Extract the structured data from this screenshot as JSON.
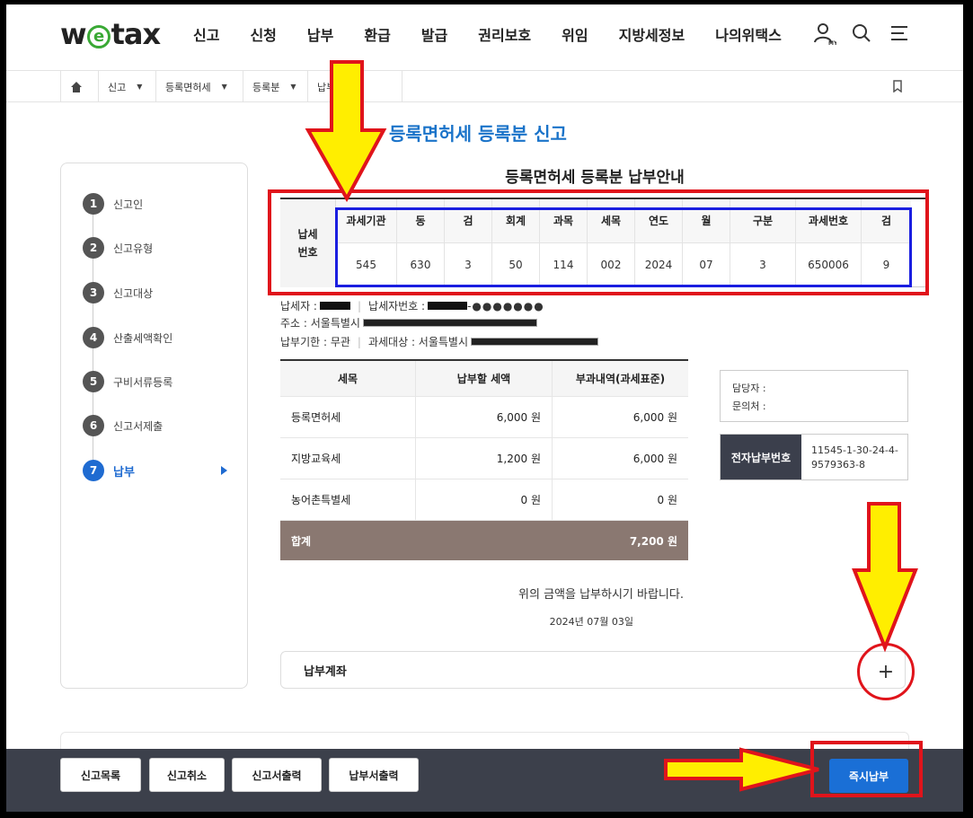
{
  "header": {
    "logo": "wetax",
    "nav": [
      "신고",
      "신청",
      "납부",
      "환급",
      "발급",
      "권리보호",
      "위임",
      "지방세정보",
      "나의위택스"
    ],
    "icons": [
      "user-my-icon",
      "search-icon",
      "menu-icon"
    ],
    "my_label": "MY"
  },
  "breadcrumb": {
    "home_icon": "home-icon",
    "items": [
      "신고",
      "등록면허세",
      "등록분",
      "납부"
    ],
    "bookmark_icon": "bookmark-icon"
  },
  "steps": [
    {
      "num": "1",
      "label": "신고인"
    },
    {
      "num": "2",
      "label": "신고유형"
    },
    {
      "num": "3",
      "label": "신고대상"
    },
    {
      "num": "4",
      "label": "산출세액확인"
    },
    {
      "num": "5",
      "label": "구비서류등록"
    },
    {
      "num": "6",
      "label": "신고서제출"
    },
    {
      "num": "7",
      "label": "납부"
    }
  ],
  "page_title": "등록면허세 등록분 신고",
  "sub_title": "등록면허세 등록분 납부안내",
  "payment_number": {
    "row_header": "납세\n번호",
    "columns": [
      {
        "h": "과세기관",
        "v": "545"
      },
      {
        "h": "동",
        "v": "630"
      },
      {
        "h": "검",
        "v": "3"
      },
      {
        "h": "회계",
        "v": "50"
      },
      {
        "h": "과목",
        "v": "114"
      },
      {
        "h": "세목",
        "v": "002"
      },
      {
        "h": "연도",
        "v": "2024"
      },
      {
        "h": "월",
        "v": "07"
      },
      {
        "h": "구분",
        "v": "3"
      },
      {
        "h": "과세번호",
        "v": "650006"
      },
      {
        "h": "검",
        "v": "9"
      }
    ]
  },
  "taxpayer": {
    "name_label": "납세자 :",
    "id_label": "납세자번호 :",
    "id_suffix": "-●●●●●●●",
    "address_label": "주소 : 서울특별시",
    "deadline_label": "납부기한 : 무관",
    "object_label": "과세대상 : 서울특별시"
  },
  "tax_table": {
    "headers": [
      "세목",
      "납부할 세액",
      "부과내역(과세표준)"
    ],
    "rows": [
      {
        "name": "등록면허세",
        "amount": "6,000 원",
        "base": "6,000 원"
      },
      {
        "name": "지방교육세",
        "amount": "1,200 원",
        "base": "6,000 원"
      },
      {
        "name": "농어촌특별세",
        "amount": "0 원",
        "base": "0 원"
      }
    ],
    "total_label": "합계",
    "total_amount": "7,200 원"
  },
  "contact": {
    "manager": "담당자 :",
    "inquiry": "문의처 :"
  },
  "epay": {
    "label": "전자납부번호",
    "value": "11545-1-30-24-4-9579363-8"
  },
  "notice": "위의 금액을 납부하시기 바랍니다.",
  "date": "2024년 07월 03일",
  "account": {
    "label": "납부계좌",
    "toggle": "+"
  },
  "bottom_bar": {
    "buttons": [
      "신고목록",
      "신고취소",
      "신고서출력",
      "납부서출력"
    ],
    "pay_now": "즉시납부"
  },
  "colors": {
    "accent_blue": "#1a73c9",
    "pay_button": "#1a6fd6",
    "bottom_bar": "#3c404b",
    "total_row": "#8a7871",
    "annotation_red": "#e0141b",
    "annotation_blue": "#1a1ee0",
    "annotation_arrow": "#ffee00"
  }
}
